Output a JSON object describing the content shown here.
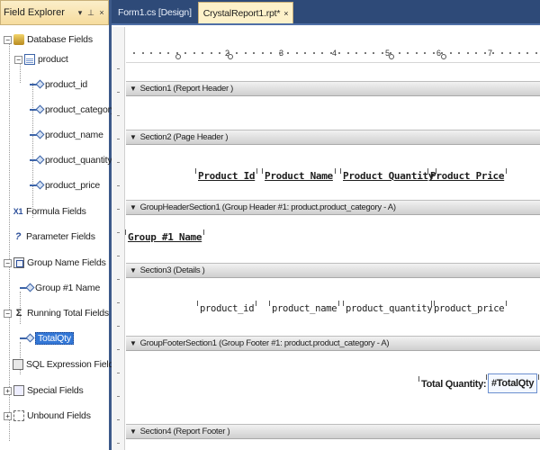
{
  "field_explorer": {
    "title": "Field Explorer",
    "pin": "▾ § ×",
    "items": [
      {
        "label": "Database Fields"
      },
      {
        "label": "product"
      },
      {
        "label": "product_id"
      },
      {
        "label": "product_category"
      },
      {
        "label": "product_name"
      },
      {
        "label": "product_quantity"
      },
      {
        "label": "product_price"
      },
      {
        "label": "Formula Fields"
      },
      {
        "label": "Parameter Fields"
      },
      {
        "label": "Group Name Fields"
      },
      {
        "label": "Group #1 Name"
      },
      {
        "label": "Running Total Fields"
      },
      {
        "label": "TotalQty"
      },
      {
        "label": "SQL Expression Fields"
      },
      {
        "label": "Special Fields"
      },
      {
        "label": "Unbound Fields"
      }
    ],
    "icons": {
      "formula": "X1",
      "param": "?"
    }
  },
  "tabs": [
    {
      "label": "Form1.cs [Design]",
      "active": false
    },
    {
      "label": "CrystalReport1.rpt*",
      "active": true,
      "close": "×"
    }
  ],
  "ruler": {
    "numbers": [
      "1",
      "2",
      "3",
      "4",
      "5",
      "6",
      "7"
    ]
  },
  "sections": [
    {
      "label": "Section1 (Report Header )"
    },
    {
      "label": "Section2 (Page Header )"
    },
    {
      "label": "GroupHeaderSection1 (Group Header #1: product.product_category - A)"
    },
    {
      "label": "Section3 (Details )"
    },
    {
      "label": "GroupFooterSection1 (Group Footer #1: product.product_category - A)"
    },
    {
      "label": "Section4 (Report Footer )"
    }
  ],
  "page_header_fields": [
    "Product Id",
    "Product Name",
    "Product Quantity",
    "Product Price"
  ],
  "group_header_field": "Group #1 Name",
  "detail_fields": [
    "product_id",
    "product_name",
    "product_quantity",
    "product_price"
  ],
  "group_footer": {
    "label": "Total Quantity:",
    "value": "#TotalQty"
  },
  "colors": {
    "tab_bar": "#2e4a78",
    "active_tab": "#fdf1c9",
    "selection": "#3377d6"
  }
}
